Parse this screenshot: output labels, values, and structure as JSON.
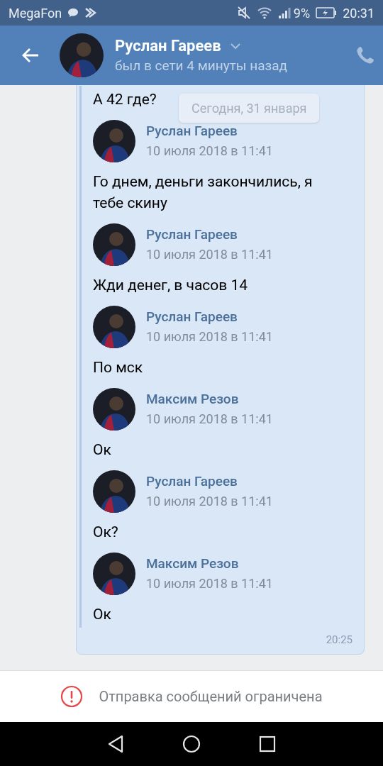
{
  "status_bar": {
    "carrier": "MegaFon",
    "battery": "9%",
    "time": "20:31"
  },
  "header": {
    "name": "Руслан Гареев",
    "status": "был в сети 4 минуты назад"
  },
  "date_badge": "Сегодня, 31 января",
  "first_text": "А 42 где?",
  "forwarded": [
    {
      "author": "Руслан Гареев",
      "date": "10 июля 2018 в 11:41",
      "text": "Го днем, деньги закончились, я тебе скину"
    },
    {
      "author": "Руслан Гареев",
      "date": "10 июля 2018 в 11:41",
      "text": "Жди денег, в часов 14"
    },
    {
      "author": "Руслан Гареев",
      "date": "10 июля 2018 в 11:41",
      "text": "По мск"
    },
    {
      "author": "Максим Резов",
      "date": "10 июля 2018 в 11:41",
      "text": "Ок"
    },
    {
      "author": "Руслан Гареев",
      "date": "10 июля 2018 в 11:41",
      "text": "Ок?"
    },
    {
      "author": "Максим Резов",
      "date": "10 июля 2018 в 11:41",
      "text": "Ок"
    }
  ],
  "message_time": "20:25",
  "restriction": "Отправка сообщений ограничена"
}
